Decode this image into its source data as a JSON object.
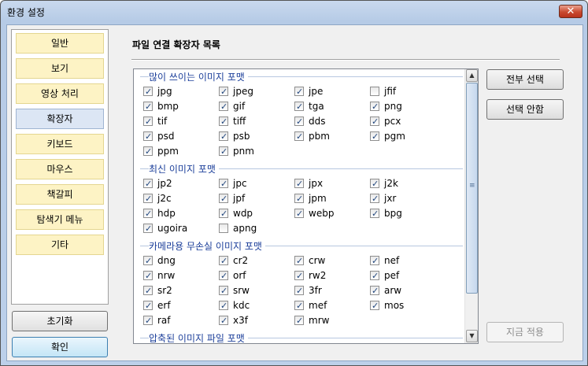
{
  "window": {
    "title": "환경 설정",
    "close_symbol": "✕"
  },
  "sidebar": {
    "items": [
      {
        "label": "일반",
        "active": false
      },
      {
        "label": "보기",
        "active": false
      },
      {
        "label": "영상 처리",
        "active": false
      },
      {
        "label": "확장자",
        "active": true
      },
      {
        "label": "키보드",
        "active": false
      },
      {
        "label": "마우스",
        "active": false
      },
      {
        "label": "책갈피",
        "active": false
      },
      {
        "label": "탐색기 메뉴",
        "active": false
      },
      {
        "label": "기타",
        "active": false
      }
    ],
    "reset_label": "초기화",
    "ok_label": "확인"
  },
  "main": {
    "heading": "파일 연결 확장자 목록",
    "select_all_label": "전부 선택",
    "deselect_label": "선택 안함",
    "apply_label": "지금 적용",
    "groups": [
      {
        "title": "많이 쓰이는 이미지 포맷",
        "items": [
          {
            "ext": "jpg",
            "checked": true
          },
          {
            "ext": "jpeg",
            "checked": true
          },
          {
            "ext": "jpe",
            "checked": true
          },
          {
            "ext": "jfif",
            "checked": false
          },
          {
            "ext": "bmp",
            "checked": true
          },
          {
            "ext": "gif",
            "checked": true
          },
          {
            "ext": "tga",
            "checked": true
          },
          {
            "ext": "png",
            "checked": true
          },
          {
            "ext": "tif",
            "checked": true
          },
          {
            "ext": "tiff",
            "checked": true
          },
          {
            "ext": "dds",
            "checked": true
          },
          {
            "ext": "pcx",
            "checked": true
          },
          {
            "ext": "psd",
            "checked": true
          },
          {
            "ext": "psb",
            "checked": true
          },
          {
            "ext": "pbm",
            "checked": true
          },
          {
            "ext": "pgm",
            "checked": true
          },
          {
            "ext": "ppm",
            "checked": true
          },
          {
            "ext": "pnm",
            "checked": true
          }
        ]
      },
      {
        "title": "최신 이미지 포맷",
        "items": [
          {
            "ext": "jp2",
            "checked": true
          },
          {
            "ext": "jpc",
            "checked": true
          },
          {
            "ext": "jpx",
            "checked": true
          },
          {
            "ext": "j2k",
            "checked": true
          },
          {
            "ext": "j2c",
            "checked": true
          },
          {
            "ext": "jpf",
            "checked": true
          },
          {
            "ext": "jpm",
            "checked": true
          },
          {
            "ext": "jxr",
            "checked": true
          },
          {
            "ext": "hdp",
            "checked": true
          },
          {
            "ext": "wdp",
            "checked": true
          },
          {
            "ext": "webp",
            "checked": true
          },
          {
            "ext": "bpg",
            "checked": true
          },
          {
            "ext": "ugoira",
            "checked": true
          },
          {
            "ext": "apng",
            "checked": false
          }
        ]
      },
      {
        "title": "카메라용 무손실 이미지 포맷",
        "items": [
          {
            "ext": "dng",
            "checked": true
          },
          {
            "ext": "cr2",
            "checked": true
          },
          {
            "ext": "crw",
            "checked": true
          },
          {
            "ext": "nef",
            "checked": true
          },
          {
            "ext": "nrw",
            "checked": true
          },
          {
            "ext": "orf",
            "checked": true
          },
          {
            "ext": "rw2",
            "checked": true
          },
          {
            "ext": "pef",
            "checked": true
          },
          {
            "ext": "sr2",
            "checked": true
          },
          {
            "ext": "srw",
            "checked": true
          },
          {
            "ext": "3fr",
            "checked": true
          },
          {
            "ext": "arw",
            "checked": true
          },
          {
            "ext": "erf",
            "checked": true
          },
          {
            "ext": "kdc",
            "checked": true
          },
          {
            "ext": "mef",
            "checked": true
          },
          {
            "ext": "mos",
            "checked": true
          },
          {
            "ext": "raf",
            "checked": true
          },
          {
            "ext": "x3f",
            "checked": true
          },
          {
            "ext": "mrw",
            "checked": true
          }
        ]
      },
      {
        "title": "압축된 이미지 파일 포맷",
        "items": []
      }
    ]
  }
}
